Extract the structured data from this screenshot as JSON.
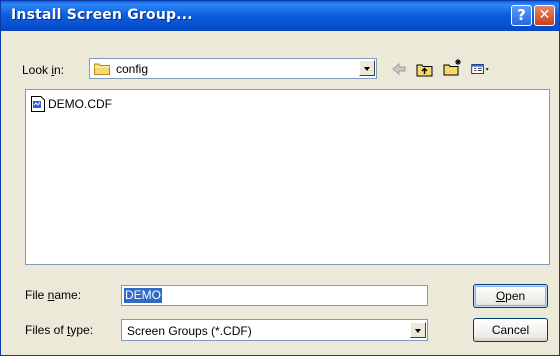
{
  "window": {
    "title": "Install Screen Group...",
    "help_glyph": "?",
    "close_glyph": "✕"
  },
  "look_in": {
    "label_prefix": "Look ",
    "label_mnemonic": "i",
    "label_suffix": "n:",
    "value": "config",
    "folder_icon": "folder-icon"
  },
  "toolbar": {
    "icons": [
      "back-arrow-icon",
      "up-one-level-icon",
      "create-new-folder-icon",
      "view-menu-icon"
    ]
  },
  "files": [
    {
      "name": "DEMO.CDF",
      "icon": "cdf-file-icon"
    }
  ],
  "file_name": {
    "label_prefix": "File ",
    "label_mnemonic": "n",
    "label_suffix": "ame:",
    "value": "DEMO"
  },
  "file_type": {
    "label_prefix": "Files of ",
    "label_mnemonic": "t",
    "label_suffix": "ype:",
    "value": "Screen Groups (*.CDF)"
  },
  "buttons": {
    "open_mnemonic": "O",
    "open_rest": "pen",
    "cancel": "Cancel"
  },
  "colors": {
    "titlebar": "#0a55d6",
    "dialog_bg": "#ece9d8",
    "selection": "#316ac5"
  }
}
